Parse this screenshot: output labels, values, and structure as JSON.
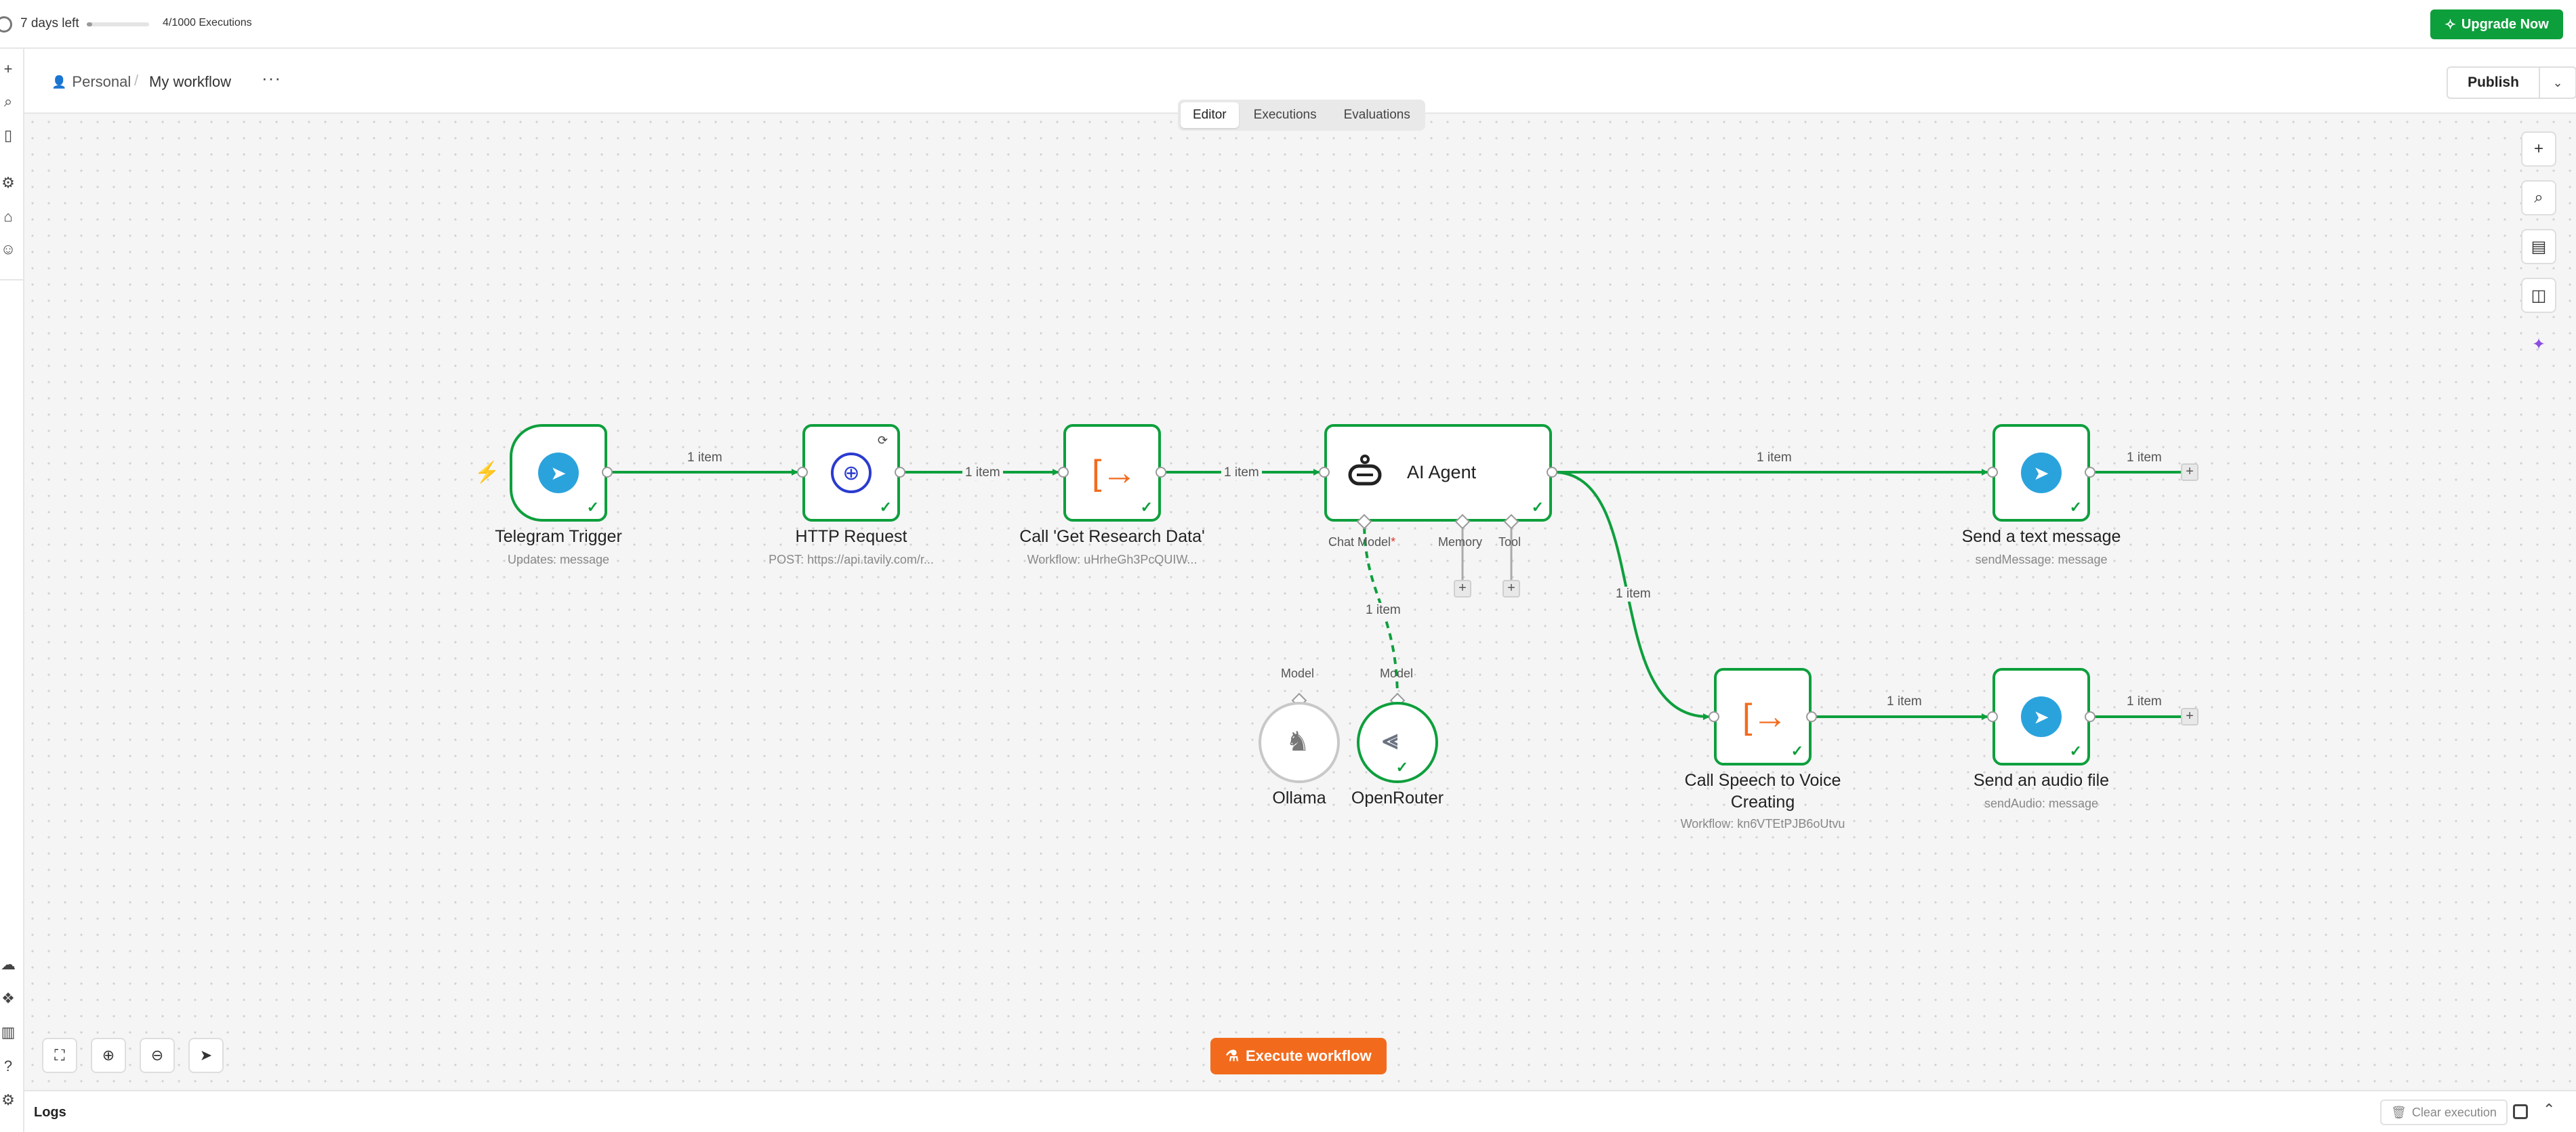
{
  "trial": {
    "days_left": "7 days left",
    "executions": "4/1000 Executions",
    "executions_used_fraction": 0.004,
    "upgrade_label": "Upgrade Now"
  },
  "breadcrumb": {
    "project": "Personal",
    "workflow_name": "My workflow",
    "more": "···"
  },
  "header": {
    "publish_label": "Publish"
  },
  "tabs": [
    {
      "label": "Editor",
      "active": true
    },
    {
      "label": "Executions",
      "active": false
    },
    {
      "label": "Evaluations",
      "active": false
    }
  ],
  "nodes": {
    "telegram_trigger": {
      "title": "Telegram Trigger",
      "subtitle": "Updates: message"
    },
    "http_request": {
      "title": "HTTP Request",
      "subtitle": "POST: https://api.tavily.com/r..."
    },
    "get_research": {
      "title": "Call 'Get Research Data'",
      "subtitle": "Workflow: uHrheGh3PcQUIW..."
    },
    "ai_agent": {
      "title": "AI Agent",
      "ports": {
        "chat_model": "Chat Model",
        "memory": "Memory",
        "tool": "Tool"
      }
    },
    "send_text": {
      "title": "Send a text message",
      "subtitle": "sendMessage: message"
    },
    "speech_voice": {
      "title_line1": "Call Speech to Voice",
      "title_line2": "Creating",
      "subtitle": "Workflow: kn6VTEtPJB6oUtvu"
    },
    "send_audio": {
      "title": "Send an audio file",
      "subtitle": "sendAudio: message"
    },
    "ollama": {
      "title": "Ollama",
      "port_label": "Model"
    },
    "openrouter": {
      "title": "OpenRouter",
      "port_label": "Model"
    }
  },
  "edge_labels": {
    "trigger_to_http": "1 item",
    "http_to_research": "1 item",
    "research_to_agent": "1 item",
    "agent_to_text": "1 item",
    "text_out": "1 item",
    "agent_to_speech": "1 item",
    "model_to_agent": "1 item",
    "speech_to_audio": "1 item",
    "audio_out": "1 item"
  },
  "required_marker": "*",
  "execute_label": "Execute workflow",
  "logs": {
    "label": "Logs",
    "clear_label": "Clear execution"
  },
  "colors": {
    "success": "#0e9f3d",
    "accent": "#f26b1d",
    "telegram": "#2aa3dd",
    "http": "#2a3bd0"
  }
}
